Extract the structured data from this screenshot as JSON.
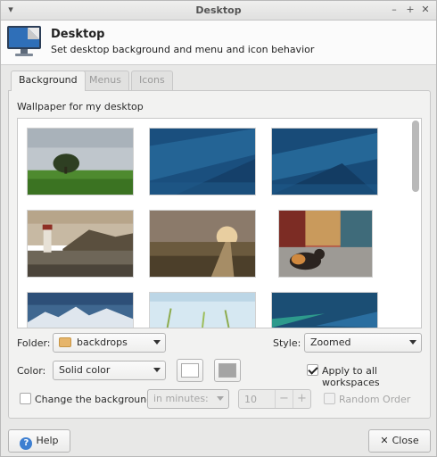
{
  "window": {
    "title": "Desktop"
  },
  "header": {
    "title": "Desktop",
    "subtitle": "Set desktop background and menu and icon behavior"
  },
  "tabs": [
    {
      "label": "Background",
      "active": true
    },
    {
      "label": "Menus",
      "active": false
    },
    {
      "label": "Icons",
      "active": false
    }
  ],
  "wallpaper": {
    "label": "Wallpaper for my desktop",
    "thumbnails": [
      {
        "name": "tree-field"
      },
      {
        "name": "blue-aurora"
      },
      {
        "name": "blue-aurora-2"
      },
      {
        "name": "lighthouse-coast"
      },
      {
        "name": "sunset-boardwalk"
      },
      {
        "name": "cat-street"
      },
      {
        "name": "mountain-lake"
      },
      {
        "name": "grass-sky"
      },
      {
        "name": "blue-green-waves"
      }
    ]
  },
  "controls": {
    "folder_label": "Folder:",
    "folder_value": "backdrops",
    "style_label": "Style:",
    "style_value": "Zoomed",
    "color_label": "Color:",
    "color_value": "Solid color",
    "primary_color": "#ffffff",
    "secondary_color": "#a4a4a4",
    "apply_all_label": "Apply to all workspaces",
    "apply_all_checked": true,
    "change_bg_label": "Change the background",
    "change_bg_checked": false,
    "interval_value": "in minutes:",
    "interval_amount": "10",
    "random_order_label": "Random Order",
    "random_order_checked": false
  },
  "buttons": {
    "help": "Help",
    "close": "Close"
  }
}
